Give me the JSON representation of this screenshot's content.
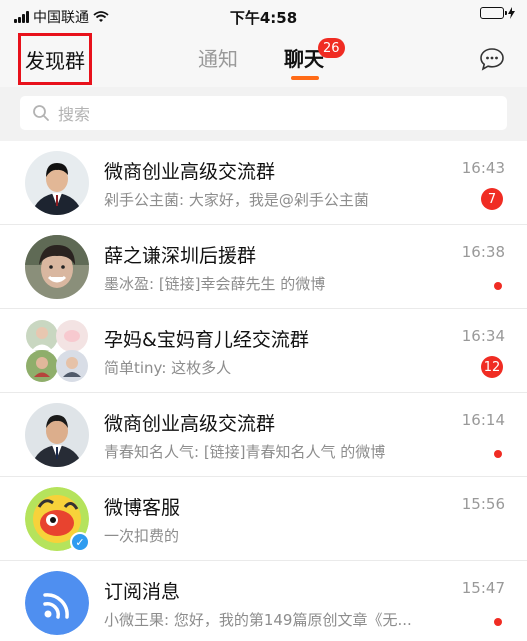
{
  "status_bar": {
    "carrier": "中国联通",
    "time": "下午4:58",
    "battery_color": "#2fd04a"
  },
  "header": {
    "discover_label": "发现群",
    "tabs": [
      {
        "label": "通知",
        "active": false
      },
      {
        "label": "聊天",
        "active": true,
        "badge": "26"
      }
    ],
    "chat_icon": "chat-bubble-icon",
    "highlight_color": "#e8111b",
    "accent_color": "#ff6b17"
  },
  "search": {
    "placeholder": "搜索",
    "icon": "search-icon"
  },
  "conversations": [
    {
      "name": "微商创业高级交流群",
      "preview": "剁手公主菌: 大家好，我是@剁手公主菌",
      "time": "16:43",
      "badge": "7"
    },
    {
      "name": "薛之谦深圳后援群",
      "preview": "墨冰盈: [链接]幸会薛先生 的微博",
      "time": "16:38",
      "unread_dot": true
    },
    {
      "name": "孕妈&宝妈育儿经交流群",
      "preview": "简单tiny: 这枚多人",
      "time": "16:34",
      "badge": "12"
    },
    {
      "name": "微商创业高级交流群",
      "preview": "青春知名人气: [链接]青春知名人气 的微博",
      "time": "16:14",
      "unread_dot": true
    },
    {
      "name": "微博客服",
      "preview": "一次扣费的",
      "time": "15:56",
      "verified": true
    },
    {
      "name": "订阅消息",
      "preview": "小微王果: 您好，我的第149篇原创文章《无...",
      "time": "15:47",
      "unread_dot": true
    }
  ]
}
